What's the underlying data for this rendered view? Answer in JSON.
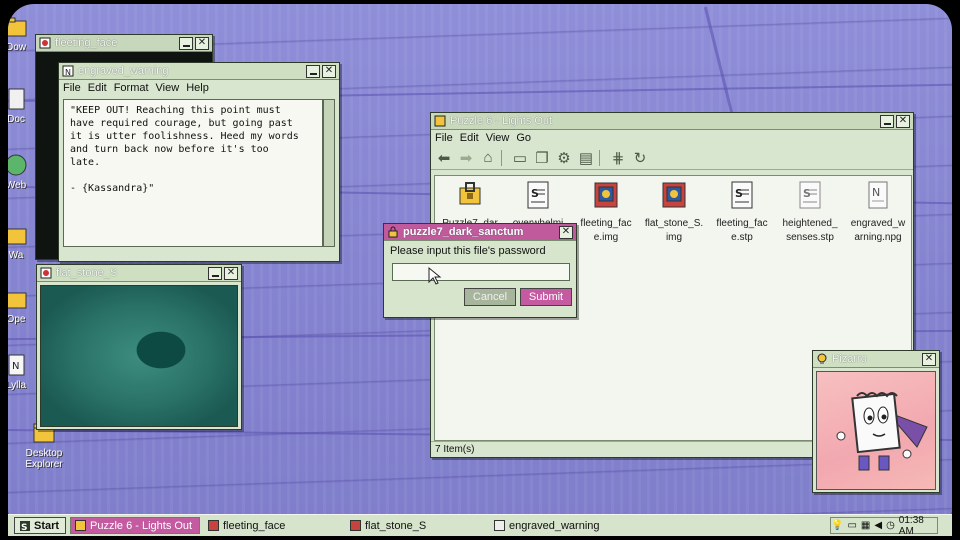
{
  "desktop_icons": [
    {
      "label": "Dow",
      "icon": "folder-icon"
    },
    {
      "label": "Doc",
      "icon": "document-icon"
    },
    {
      "label": "Web",
      "icon": "globe-icon"
    },
    {
      "label": "Wa",
      "icon": "folder-icon"
    },
    {
      "label": "Ope",
      "icon": "folder-icon"
    },
    {
      "label": "Lylla",
      "icon": "notepad-icon"
    },
    {
      "label": "Desktop Explorer",
      "icon": "folder-icon"
    }
  ],
  "windows": {
    "fleeting_face": {
      "title": "fleeting_face"
    },
    "engraved_warning": {
      "title": "engraved_warning",
      "menu": [
        "File",
        "Edit",
        "Format",
        "View",
        "Help"
      ],
      "body": "\"KEEP OUT! Reaching this point must\nhave required courage, but going past\nit is utter foolishness. Heed my words\nand turn back now before it's too\nlate.\n\n- {Kassandra}\""
    },
    "flat_stone_S": {
      "title": "flat_stone_S"
    },
    "explorer": {
      "title": "Puzzle 6 - Lights Out",
      "menu": [
        "File",
        "Edit",
        "View",
        "Go"
      ],
      "toolbar": [
        "back-arrow-icon",
        "forward-arrow-icon",
        "up-folder-icon",
        "cut-icon",
        "copy-icon",
        "settings-icon",
        "paste-icon",
        "network-icon",
        "refresh-icon"
      ],
      "files": [
        {
          "name": "Puzzle7_dar",
          "icon": "locked-folder-icon"
        },
        {
          "name": "overwhelmi",
          "icon": "script-file-icon"
        },
        {
          "name": "fleeting_fac\ne.img",
          "icon": "image-file-icon"
        },
        {
          "name": "flat_stone_S.\nimg",
          "icon": "image-file-icon"
        },
        {
          "name": "fleeting_fac\ne.stp",
          "icon": "script-file-icon"
        },
        {
          "name": "heightened_\nsenses.stp",
          "icon": "script-file-icon"
        },
        {
          "name": "engraved_w\narning.npg",
          "icon": "notepad-file-icon"
        }
      ],
      "status": "7 Item(s)"
    },
    "password_dialog": {
      "title": "puzzle7_dark_sanctum",
      "prompt": "Please input this file's password",
      "value": "",
      "cancel": "Cancel",
      "submit": "Submit"
    },
    "pizarro": {
      "title": "Pizarro"
    }
  },
  "taskbar": {
    "start": "Start",
    "tasks": [
      {
        "label": "Puzzle 6 - Lights Out",
        "active": true
      },
      {
        "label": "fleeting_face",
        "active": false
      },
      {
        "label": "flat_stone_S",
        "active": false
      },
      {
        "label": "engraved_warning",
        "active": false
      }
    ],
    "clock": "01:38 AM"
  },
  "colors": {
    "accent": "#c45aa0",
    "window_bg": "#d9e6cf",
    "desktop": "#8584d0"
  }
}
